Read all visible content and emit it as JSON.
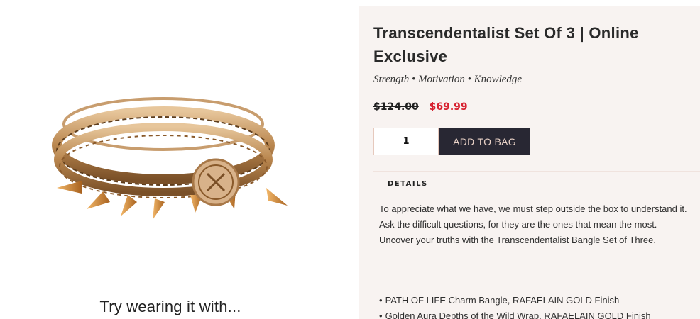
{
  "product": {
    "title": "Transcendentalist Set Of 3 | Online Exclusive",
    "tagline": "Strength • Motivation • Knowledge",
    "price_original": "$124.00",
    "price_sale": "$69.99",
    "quantity": "1",
    "add_to_bag_label": "ADD TO BAG"
  },
  "details": {
    "label": "DETAILS",
    "description": "To appreciate what we have, we must step outside the box to understand it. Ask the difficult questions, for they are the ones that mean the most. Uncover your truths with the Transcendentalist Bangle Set of Three.",
    "features": [
      "PATH OF LIFE Charm Bangle, RAFAELAIN GOLD Finish",
      "Golden Aura Depths of the Wild Wrap, RAFAELAIN GOLD Finish"
    ]
  },
  "recommend": {
    "heading": "Try wearing it with..."
  },
  "colors": {
    "accent_sale": "#d7202f",
    "button_bg": "#282733",
    "button_text": "#e9d2c7",
    "panel_bg": "#f8f3f1"
  }
}
